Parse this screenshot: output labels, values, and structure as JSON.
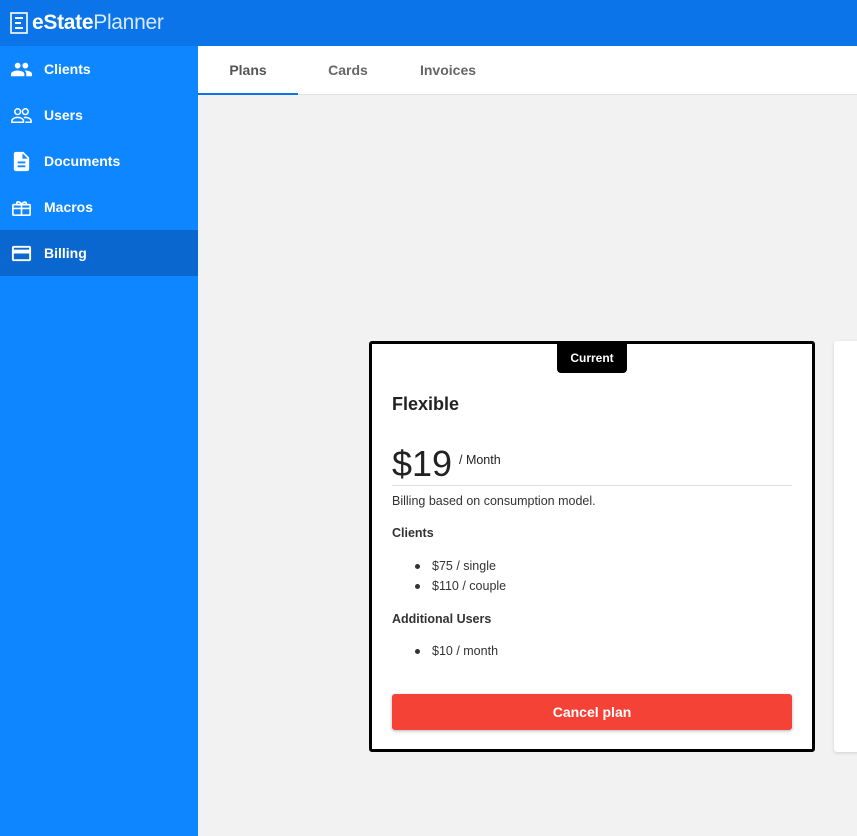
{
  "app": {
    "logo_bold": "eState",
    "logo_light": "Planner"
  },
  "sidebar": {
    "items": [
      {
        "label": "Clients",
        "icon": "people-icon"
      },
      {
        "label": "Users",
        "icon": "users-outline-icon"
      },
      {
        "label": "Documents",
        "icon": "document-icon"
      },
      {
        "label": "Macros",
        "icon": "gift-box-icon"
      },
      {
        "label": "Billing",
        "icon": "credit-card-icon",
        "active": true
      }
    ]
  },
  "tabs": [
    {
      "label": "Plans",
      "active": true
    },
    {
      "label": "Cards"
    },
    {
      "label": "Invoices"
    }
  ],
  "plan": {
    "badge": "Current",
    "name": "Flexible",
    "price": "$19",
    "period": "/ Month",
    "description": "Billing based on consumption model.",
    "clients_heading": "Clients",
    "clients_items": [
      "$75 / single",
      "$110 / couple"
    ],
    "users_heading": "Additional Users",
    "users_items": [
      "$10 / month"
    ],
    "cancel_label": "Cancel plan"
  },
  "colors": {
    "header": "#0a74e8",
    "sidebar": "#0d86ff",
    "sidebar_active": "#0a67cf",
    "cancel": "#f44336"
  }
}
